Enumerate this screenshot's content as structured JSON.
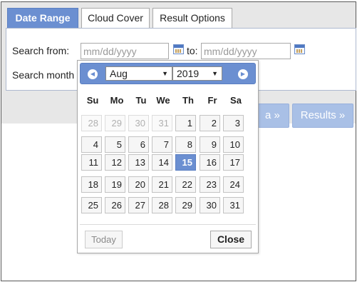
{
  "tabs": [
    {
      "label": "Date Range",
      "active": true
    },
    {
      "label": "Cloud Cover",
      "active": false
    },
    {
      "label": "Result Options",
      "active": false
    }
  ],
  "form": {
    "search_from_label": "Search from:",
    "from_placeholder": "mm/dd/yyyy",
    "to_label": "to:",
    "to_placeholder": "mm/dd/yyyy",
    "search_months_label": "Search month"
  },
  "nav_buttons": {
    "data_label": "a »",
    "results_label": "Results »"
  },
  "datepicker": {
    "month": "Aug",
    "year": "2019",
    "weekdays": [
      "Su",
      "Mo",
      "Tu",
      "We",
      "Th",
      "Fr",
      "Sa"
    ],
    "weeks": [
      [
        {
          "d": "28",
          "other": true
        },
        {
          "d": "29",
          "other": true
        },
        {
          "d": "30",
          "other": true
        },
        {
          "d": "31",
          "other": true
        },
        {
          "d": "1"
        },
        {
          "d": "2"
        },
        {
          "d": "3"
        }
      ],
      [
        {
          "d": "4"
        },
        {
          "d": "5"
        },
        {
          "d": "6"
        },
        {
          "d": "7"
        },
        {
          "d": "8"
        },
        {
          "d": "9"
        },
        {
          "d": "10"
        }
      ],
      [
        {
          "d": "11"
        },
        {
          "d": "12"
        },
        {
          "d": "13"
        },
        {
          "d": "14"
        },
        {
          "d": "15",
          "selected": true
        },
        {
          "d": "16"
        },
        {
          "d": "17"
        }
      ],
      [
        {
          "d": "18"
        },
        {
          "d": "19"
        },
        {
          "d": "20"
        },
        {
          "d": "21"
        },
        {
          "d": "22"
        },
        {
          "d": "23"
        },
        {
          "d": "24"
        }
      ],
      [
        {
          "d": "25"
        },
        {
          "d": "26"
        },
        {
          "d": "27"
        },
        {
          "d": "28"
        },
        {
          "d": "29"
        },
        {
          "d": "30"
        },
        {
          "d": "31"
        }
      ]
    ],
    "today_label": "Today",
    "close_label": "Close",
    "prev_icon": "chevron-left-icon",
    "next_icon": "chevron-right-icon"
  },
  "colors": {
    "accent": "#6b8fd1",
    "disabled_button": "#a9c0e6",
    "background_band": "#e7e7e7"
  }
}
